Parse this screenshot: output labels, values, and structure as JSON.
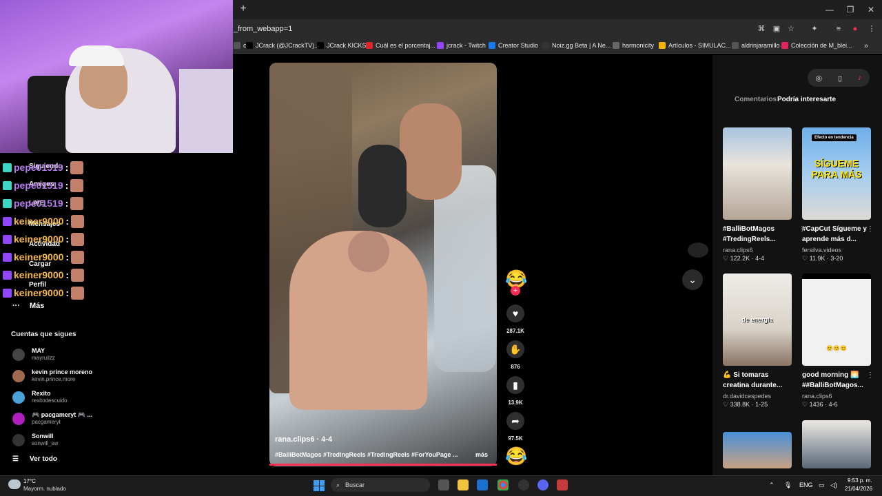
{
  "browser": {
    "url_fragment": "_from_webapp=1",
    "newtab_label": "+",
    "bookmarks": [
      {
        "label": "ch",
        "color": "#555"
      },
      {
        "label": "JCrack (@JCrackTV)...",
        "color": "#000"
      },
      {
        "label": "JCrack KICKS",
        "color": "#000"
      },
      {
        "label": "Cuál es el porcentaj...",
        "color": "#e0242a"
      },
      {
        "label": "jcrack - Twitch",
        "color": "#9146ff"
      },
      {
        "label": "Creator Studio",
        "color": "#1877f2"
      },
      {
        "label": "Noiz.gg Beta | A Ne...",
        "color": "#333"
      },
      {
        "label": "harmonicity",
        "color": "#666"
      },
      {
        "label": "Artículos - SIMULAC...",
        "color": "#f4b400"
      },
      {
        "label": "aldrinjaramillo",
        "color": "#555"
      },
      {
        "label": "Colección de M_blei...",
        "color": "#e0245e"
      }
    ]
  },
  "chat": {
    "rows": [
      {
        "user": "pepe01519",
        "color": "#b67cf0"
      },
      {
        "user": "pepe01519",
        "color": "#b67cf0"
      },
      {
        "user": "pepe01519",
        "color": "#b67cf0"
      },
      {
        "user": "keiner9000",
        "color": "#f4b942"
      },
      {
        "user": "keiner9000",
        "color": "#f4b942"
      },
      {
        "user": "keiner9000",
        "color": "#f4b942"
      },
      {
        "user": "keiner9000",
        "color": "#f4b942"
      },
      {
        "user": "keiner9000",
        "color": "#f4b942"
      }
    ],
    "separator": ":"
  },
  "sidebar": {
    "nav_overlay": [
      "Siguiendo",
      "Amigos",
      "LIVE",
      "Mensajes",
      "Actividad",
      "Cargar",
      "Perfil"
    ],
    "more_label": "Más",
    "following_title": "Cuentas que sigues",
    "accounts": [
      {
        "name": "MAY",
        "handle": "mayruilzz",
        "color": "#444"
      },
      {
        "name": "kevin prince moreno",
        "handle": "kevin.prince.more",
        "color": "#a06a50"
      },
      {
        "name": "Rexito",
        "handle": "rexitodescuido",
        "color": "#4aa3d8"
      },
      {
        "name": "🎮 pacgameryt 🎮 ...",
        "handle": "pacgameryt",
        "color": "#b020c0"
      },
      {
        "name": "Sonwill",
        "handle": "sonwill_sw",
        "color": "#333"
      }
    ],
    "see_all": "Ver todo"
  },
  "video": {
    "author": "rana.clips6 · 4-4",
    "caption": "#BalliBotMagos #TredingReels #TredingReels #ForYouPage ...",
    "more": "más",
    "progress": 1.0
  },
  "actions": {
    "likes": "287.1K",
    "comments": "876",
    "saves": "13.9K",
    "shares": "97.5K"
  },
  "right_panel": {
    "tabs": [
      "Comentarios",
      "Podría interesarte"
    ],
    "cards": [
      {
        "title": "#BalliBotMagos #TredingReels...",
        "author": "rana.clips6",
        "stats": "♡ 122.2K · 4-4",
        "color": "#b9b4ac"
      },
      {
        "title": "#CapCut Sígueme y aprende más d...",
        "author": "fersilva.videos",
        "stats": "♡ 11.9K · 3-20",
        "color": "#5a9ad8",
        "overlay_tag": "Efecto en tendencia",
        "overlay_text": "SÍGUEME PARA MÁS"
      },
      {
        "title": "💪 Si tomaras creatina durante...",
        "author": "dr.davidcespedes",
        "stats": "♡ 338.8K · 1-25",
        "color": "#e8e4df",
        "overlay_text": "de energía"
      },
      {
        "title": "good morning 🌅 ##BalliBotMagos...",
        "author": "rana.clips6",
        "stats": "♡ 1436 · 4-6",
        "color": "#efefef",
        "overlay_text": "😊😊😊"
      }
    ]
  },
  "taskbar": {
    "temp": "17°C",
    "weather": "Mayorm. nublado",
    "search": "Buscar",
    "lang": "ENG",
    "time": "9:53 p. m.",
    "date": "21/04/2026"
  }
}
